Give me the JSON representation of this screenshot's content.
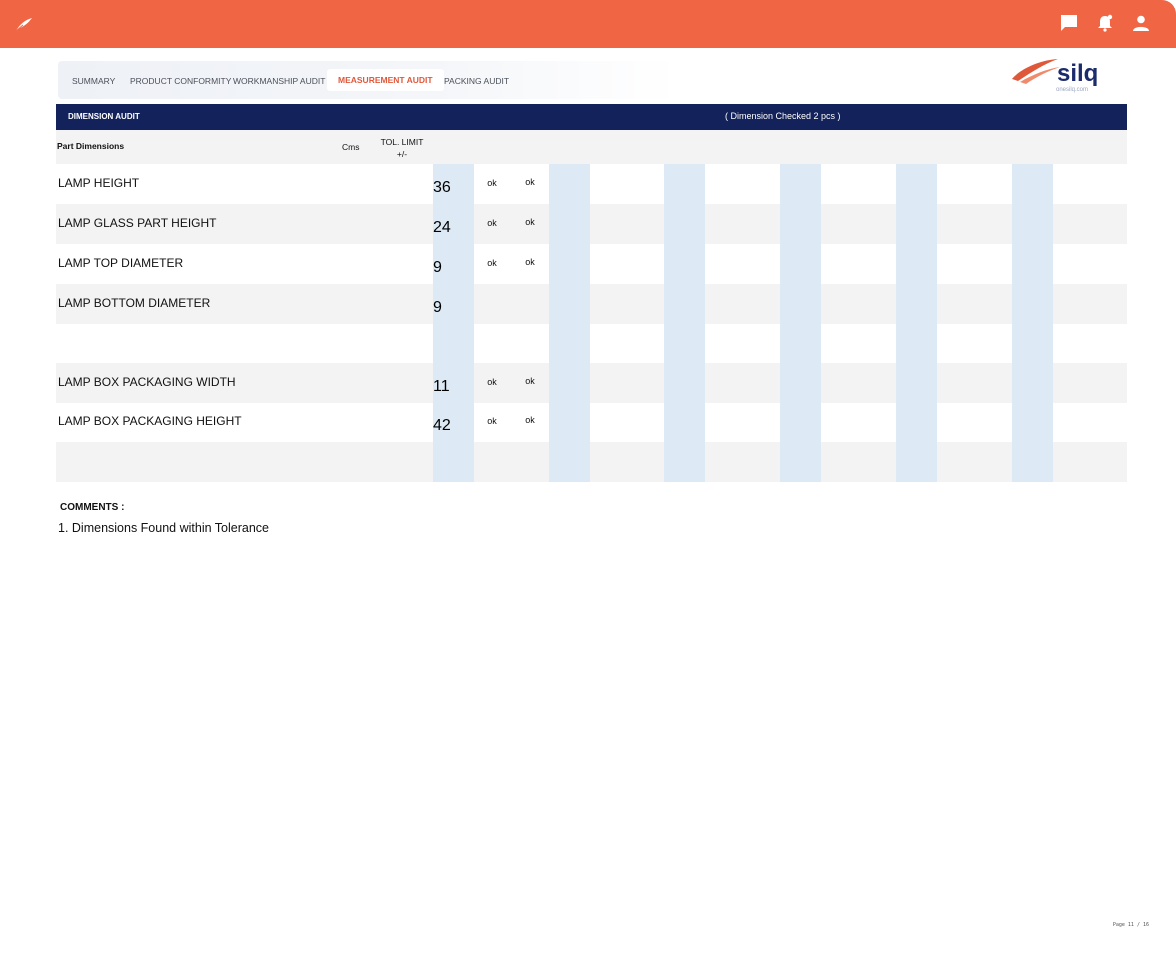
{
  "topbar": {
    "icons": [
      "feather-logo-icon",
      "chat-icon",
      "notification-bell-icon",
      "user-icon"
    ],
    "color": "#f06644"
  },
  "tabs": [
    {
      "label": "SUMMARY",
      "active": false
    },
    {
      "label": "PRODUCT CONFORMITY",
      "active": false
    },
    {
      "label": "WORKMANSHIP AUDIT",
      "active": false
    },
    {
      "label": "MEASUREMENT AUDIT",
      "active": true
    },
    {
      "label": "PACKING AUDIT",
      "active": false
    }
  ],
  "brand": {
    "name": "silq",
    "url_text": "onesilq.com"
  },
  "section": {
    "title": "DIMENSION AUDIT",
    "subtitle": "( Dimension Checked 2 pcs )"
  },
  "columns": {
    "part": "Part Dimensions",
    "unit": "Cms",
    "tol_line1": "TOL. LIMIT",
    "tol_line2": "+/-"
  },
  "rows": [
    {
      "name": "LAMP HEIGHT",
      "tol": "36",
      "p1": "ok",
      "p2": "ok"
    },
    {
      "name": "LAMP GLASS PART HEIGHT",
      "tol": "24",
      "p1": "ok",
      "p2": "ok"
    },
    {
      "name": "LAMP TOP DIAMETER",
      "tol": "9",
      "p1": "ok",
      "p2": "ok"
    },
    {
      "name": "LAMP BOTTOM DIAMETER",
      "tol": "9",
      "p1": "",
      "p2": ""
    },
    {
      "name": "",
      "tol": "",
      "p1": "",
      "p2": ""
    },
    {
      "name": "LAMP BOX PACKAGING WIDTH",
      "tol": "11",
      "p1": "ok",
      "p2": "ok"
    },
    {
      "name": "LAMP BOX PACKAGING HEIGHT",
      "tol": "42",
      "p1": "ok",
      "p2": "ok"
    },
    {
      "name": "",
      "tol": "",
      "p1": "",
      "p2": ""
    }
  ],
  "comments": {
    "title": "COMMENTS :",
    "line1": "1. Dimensions Found within Tolerance"
  },
  "page": "Page 11 / 16",
  "colors": {
    "accent": "#f06644",
    "header_bg": "#13225a",
    "highlight_col": "#dde9f4",
    "tol_text": "#2d79bd"
  }
}
